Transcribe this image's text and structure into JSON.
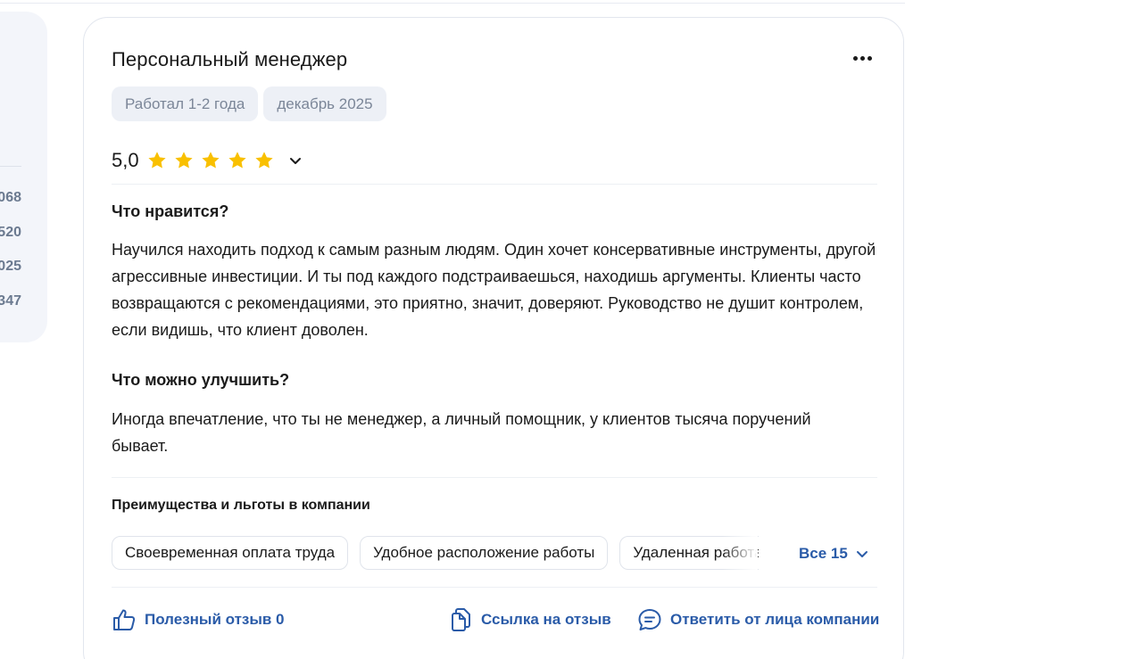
{
  "side_panel": {
    "numbers": [
      "068",
      "520",
      "025",
      "347"
    ]
  },
  "review": {
    "title": "Персональный менеджер",
    "tags": [
      "Работал 1-2 года",
      "декабрь 2025"
    ],
    "rating": "5,0",
    "stars_filled": 5,
    "stars_total": 5,
    "star_color": "#f9c000",
    "likes_heading": "Что нравится?",
    "likes_text": "Научился находить подход к самым разным людям. Один хочет консервативные инструменты, другой агрессивные инвестиции. И ты под каждого подстраиваешься, находишь аргументы. Клиенты часто возвращаются с рекомендациями, это приятно, значит, доверяют. Руководство не душит контролем, если видишь, что клиент доволен.",
    "improve_heading": "Что можно улучшить?",
    "improve_text": "Иногда впечатление, что ты не менеджер, а личный помощник, у клиентов тысяча поручений бывает.",
    "benefits_heading": "Преимущества и льготы в компании",
    "benefits": [
      "Своевременная оплата труда",
      "Удобное расположение работы",
      "Удаленная работа"
    ],
    "benefits_all_label": "Все 15",
    "actions": {
      "helpful": "Полезный отзыв 0",
      "link": "Ссылка на отзыв",
      "reply": "Ответить от лица компании"
    }
  },
  "colors": {
    "accent": "#2a5ba8",
    "chip_bg": "#edf0f6",
    "muted_text": "#7b8698"
  }
}
